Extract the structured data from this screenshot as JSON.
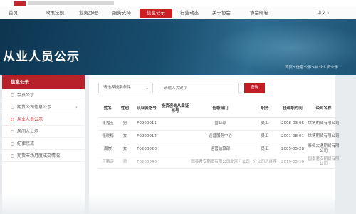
{
  "nav": {
    "items": [
      "首页",
      "政策法规",
      "业务办理",
      "服务支持",
      "信息公示",
      "行业动态",
      "关于协会",
      "协会邮箱"
    ],
    "active_index": 4,
    "language": "中文"
  },
  "banner": {
    "title": "从业人员公示",
    "breadcrumb": "首页>信息公示>从业人员公示"
  },
  "sidebar": {
    "header": "信息公示",
    "items": [
      {
        "label": "会员公示",
        "arrow": false
      },
      {
        "label": "期货公司信息公示",
        "arrow": true
      },
      {
        "label": "从业人员公示",
        "arrow": false
      },
      {
        "label": "居间人公示",
        "arrow": false
      },
      {
        "label": "纪律惩戒",
        "arrow": false
      },
      {
        "label": "期货市场月度成交情况",
        "arrow": false
      }
    ],
    "active_index": 2
  },
  "search": {
    "select_placeholder": "请选择搜索条件",
    "input_placeholder": "请输入关键字",
    "button_label": "查询"
  },
  "table": {
    "headers": [
      "姓名",
      "性别",
      "从业资格号",
      "投资咨询从业证书号",
      "任职部门",
      "职务",
      "任现职时间",
      "公司名称"
    ],
    "rows": [
      [
        "张福玉",
        "男",
        "F0200011",
        "",
        "营业部",
        "员工",
        "2008-03-06",
        "世博期货有限公司"
      ],
      [
        "张晓梅",
        "女",
        "F0200012",
        "",
        "运营服务中心",
        "员工",
        "2001-08-01",
        "世博期货有限公司"
      ],
      [
        "周崇",
        "女",
        "F0200020",
        "",
        "运营结算部",
        "员工",
        "2005-05-28",
        "泰恒大通期货有限公司"
      ],
      [
        "王鹏涛",
        "男",
        "F0200040",
        "",
        "国泰君安期货有限公司北京分公司",
        "分公司总经理",
        "2019-05-10",
        "国泰君安期货有限公司"
      ]
    ]
  },
  "colors": {
    "accent": "#c91f25",
    "banner": "#194d6e"
  }
}
